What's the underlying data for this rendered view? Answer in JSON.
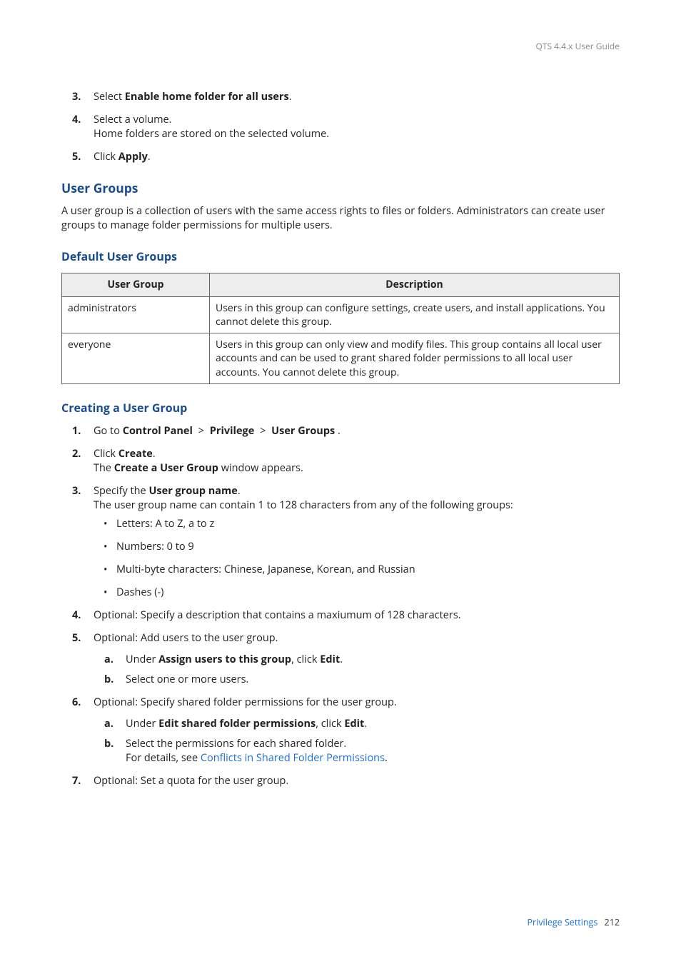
{
  "header": {
    "guide_title": "QTS 4.4.x User Guide"
  },
  "steps_top": [
    {
      "n": "3.",
      "pre": "Select ",
      "bold": "Enable home folder for all users",
      "post": "."
    },
    {
      "n": "4.",
      "line1": "Select a volume.",
      "line2": "Home folders are stored on the selected volume."
    },
    {
      "n": "5.",
      "pre": "Click ",
      "bold": "Apply",
      "post": "."
    }
  ],
  "sections": {
    "user_groups": {
      "title": "User Groups",
      "para": "A user group is a collection of users with the same access rights to files or folders. Administrators can create user groups to manage folder permissions for multiple users."
    },
    "default_user_groups": {
      "title": "Default User Groups",
      "table": {
        "headers": [
          "User Group",
          "Description"
        ],
        "rows": [
          {
            "c1": "administrators",
            "c2": "Users in this group can configure settings, create users, and install applications. You cannot delete this group."
          },
          {
            "c1": "everyone",
            "c2": "Users in this group can only view and modify files. This group contains all local user accounts and can be used to grant shared folder permissions to all local user accounts. You cannot delete this group."
          }
        ]
      }
    },
    "creating_user_group": {
      "title": "Creating a User Group",
      "steps": [
        {
          "n": "1.",
          "pre": "Go to ",
          "bold1": "Control Panel",
          "sep": ">",
          "bold2": "Privilege",
          "bold3": "User Groups",
          "post": " ."
        },
        {
          "n": "2.",
          "pre": "Click ",
          "bold": "Create",
          "post": ".",
          "line2_pre": "The ",
          "line2_bold": "Create a User Group",
          "line2_post": " window appears."
        },
        {
          "n": "3.",
          "pre": "Specify the ",
          "bold": "User group name",
          "post": ".",
          "line2": "The user group name can contain 1 to 128 characters from any of the following groups:",
          "bullets": [
            "Letters: A to Z, a to z",
            "Numbers: 0 to 9",
            "Multi-byte characters: Chinese, Japanese, Korean, and Russian",
            "Dashes (-)"
          ]
        },
        {
          "n": "4.",
          "text": "Optional: Specify a description that contains a maxiumum of 128 characters."
        },
        {
          "n": "5.",
          "text": "Optional: Add users to the user group.",
          "sub": [
            {
              "m": "a.",
              "pre": "Under ",
              "bold": "Assign users to this group",
              "mid": ", click ",
              "bold2": "Edit",
              "post": "."
            },
            {
              "m": "b.",
              "text": "Select one or more users."
            }
          ]
        },
        {
          "n": "6.",
          "text": "Optional: Specify shared folder permissions for the user group.",
          "sub": [
            {
              "m": "a.",
              "pre": "Under ",
              "bold": "Edit shared folder permissions",
              "mid": ", click ",
              "bold2": "Edit",
              "post": "."
            },
            {
              "m": "b.",
              "text": "Select the permissions for each shared folder.",
              "line2_pre": "For details, see ",
              "link": "Conflicts in Shared Folder Permissions",
              "line2_post": "."
            }
          ]
        },
        {
          "n": "7.",
          "text": "Optional: Set a quota for the user group."
        }
      ]
    }
  },
  "footer": {
    "section": "Privilege Settings",
    "page": "212"
  }
}
